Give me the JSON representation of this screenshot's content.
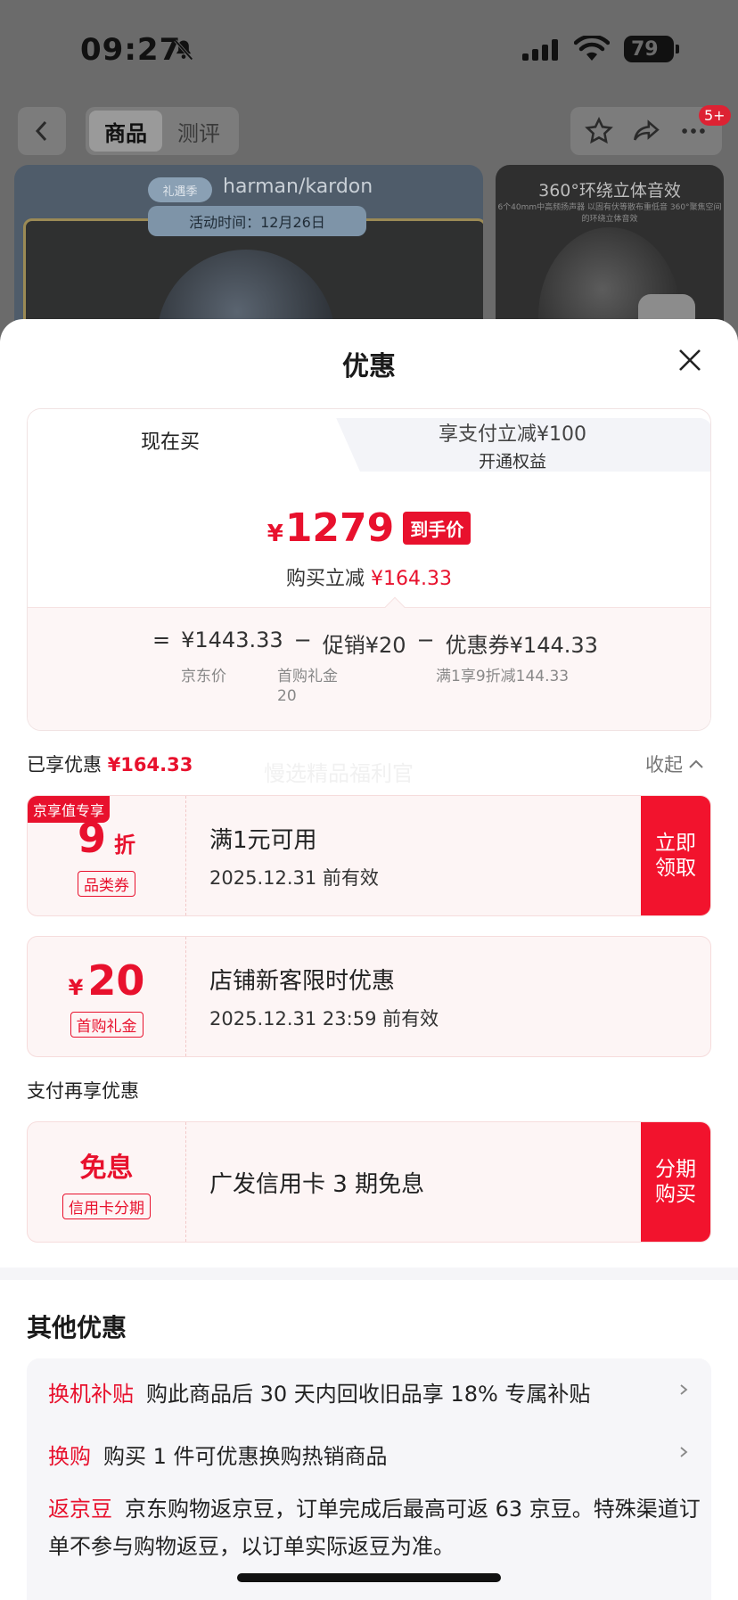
{
  "status_bar": {
    "time": "09:27",
    "battery": "79"
  },
  "nav": {
    "tabs": [
      "商品",
      "测评"
    ],
    "active_tab": 0,
    "badge": "5+"
  },
  "hero": {
    "brand": "harman/kardon",
    "logo_text": "礼遇季",
    "event_text": "活动时间：12月26日",
    "side_title": "360°环绕立体音效",
    "side_sub": "6个40mm中高频扬声器 以固有伏等散布重低音 360°聚焦空间的环绕立体音效"
  },
  "sheet": {
    "title": "优惠",
    "tab_now": "现在买",
    "tab_pay_line1": "享支付立减¥100",
    "tab_pay_line2": "开通权益",
    "currency": "¥",
    "final_price": "1279",
    "final_tag": "到手价",
    "reduce_label": "购买立减",
    "reduce_amount": "¥164.33",
    "calc": {
      "equals": "=",
      "minus": "−",
      "jd_price": "¥1443.33",
      "jd_label": "京东价",
      "promo": "促销¥20",
      "promo_sub1": "首购礼金",
      "promo_sub2": "20",
      "coupon": "优惠券¥144.33",
      "coupon_sub": "满1享9折减144.33"
    },
    "enjoyed_label": "已享优惠",
    "enjoyed_amount": "¥164.33",
    "collapse_label": "收起",
    "watermark": "慢选精品福利官",
    "coupons": [
      {
        "corner": "京享值专享",
        "value": "9",
        "unit": "折",
        "type": "品类券",
        "title": "满1元可用",
        "date": "2025.12.31 前有效",
        "action": "立即领取"
      },
      {
        "currency": "¥",
        "value": "20",
        "type": "首购礼金",
        "title": "店铺新客限时优惠",
        "date": "2025.12.31 23:59 前有效"
      }
    ],
    "pay_section_title": "支付再享优惠",
    "pay_offer": {
      "value": "免息",
      "type": "信用卡分期",
      "title": "广发信用卡 3 期免息",
      "action": "分期购买"
    },
    "other_title": "其他优惠",
    "others": [
      {
        "tag": "换机补贴",
        "text": "购此商品后 30 天内回收旧品享 18% 专属补贴"
      },
      {
        "tag": "换购",
        "text": "购买 1 件可优惠换购热销商品"
      },
      {
        "tag": "返京豆",
        "text": "京东购物返京豆，订单完成后最高可返 63 京豆。特殊渠道订单不参与购物返豆，以订单实际返豆为准。"
      }
    ]
  },
  "colors": {
    "accent": "#e8112d",
    "action": "#f2132d"
  }
}
